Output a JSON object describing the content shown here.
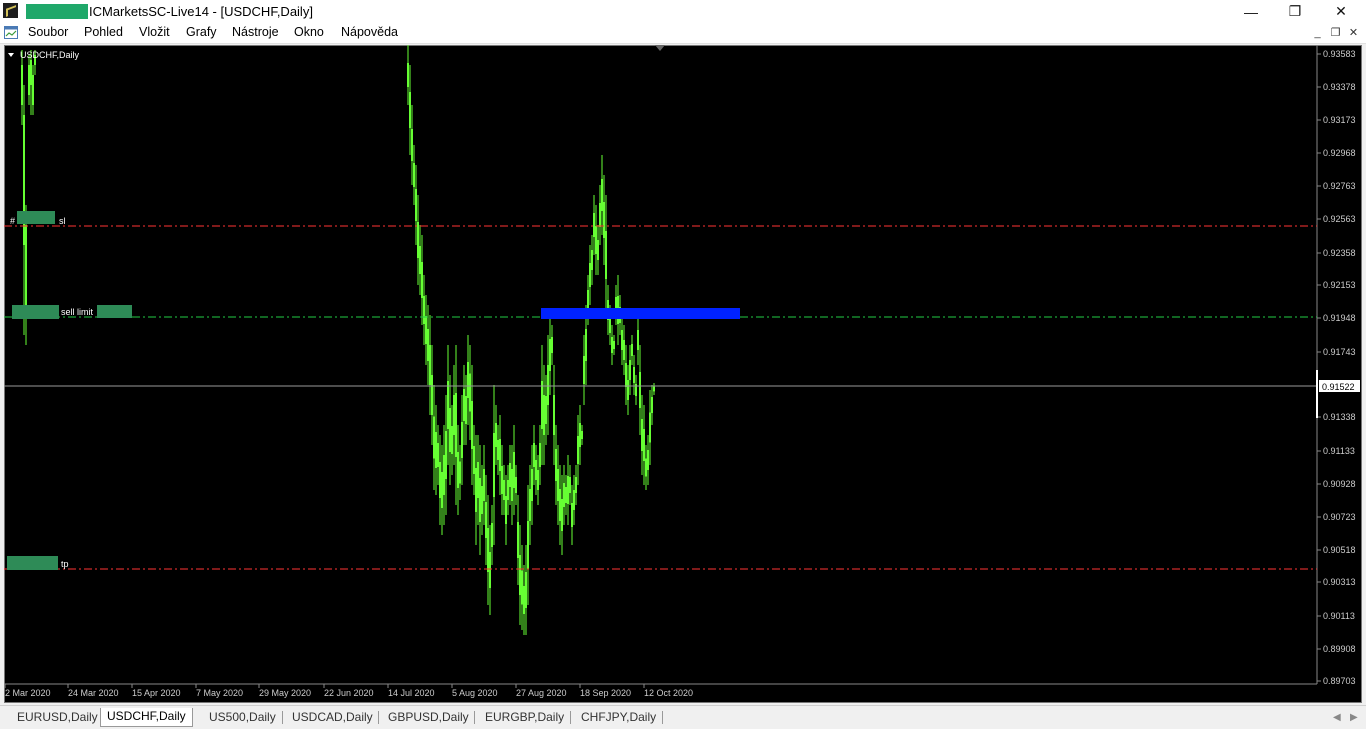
{
  "window": {
    "title": "ICMarketsSC-Live14 - [USDCHF,Daily]",
    "redact_color": "#2e8b57",
    "minimize_glyph": "—",
    "restore_glyph": "❐",
    "close_glyph": "✕"
  },
  "menu": {
    "items": [
      "Soubor",
      "Pohled",
      "Vložit",
      "Grafy",
      "Nástroje",
      "Okno",
      "Nápověda"
    ]
  },
  "chart": {
    "label": "USDCHF,Daily",
    "background": "#000000",
    "candle_color": "#66ff33",
    "current_price": "0.91522",
    "price_ticks": [
      "0.93583",
      "0.93378",
      "0.93173",
      "0.92968",
      "0.92763",
      "0.92563",
      "0.92358",
      "0.92153",
      "0.91948",
      "0.91743",
      "0.91338",
      "0.91133",
      "0.90928",
      "0.90723",
      "0.90518",
      "0.90313",
      "0.90113",
      "0.89908",
      "0.89703"
    ],
    "date_ticks": [
      "2 Mar 2020",
      "24 Mar 2020",
      "15 Apr 2020",
      "7 May 2020",
      "29 May 2020",
      "22 Jun 2020",
      "14 Jul 2020",
      "5 Aug 2020",
      "27 Aug 2020",
      "18 Sep 2020",
      "12 Oct 2020"
    ],
    "orders": {
      "sl_label": "sl",
      "sl_prefix": "#",
      "sl_color": "#ff3333",
      "sell_limit_label": "sell limit",
      "sell_limit_color": "#22cc44",
      "tp_label": "tp",
      "tp_color": "#ff3333",
      "zone_color": "#0022ff"
    }
  },
  "tabs": [
    {
      "label": "EURUSD,Daily",
      "active": false
    },
    {
      "label": "USDCHF,Daily",
      "active": true
    },
    {
      "label": "US500,Daily",
      "active": false
    },
    {
      "label": "USDCAD,Daily",
      "active": false
    },
    {
      "label": "GBPUSD,Daily",
      "active": false
    },
    {
      "label": "EURGBP,Daily",
      "active": false
    },
    {
      "label": "CHFJPY,Daily",
      "active": false
    }
  ]
}
